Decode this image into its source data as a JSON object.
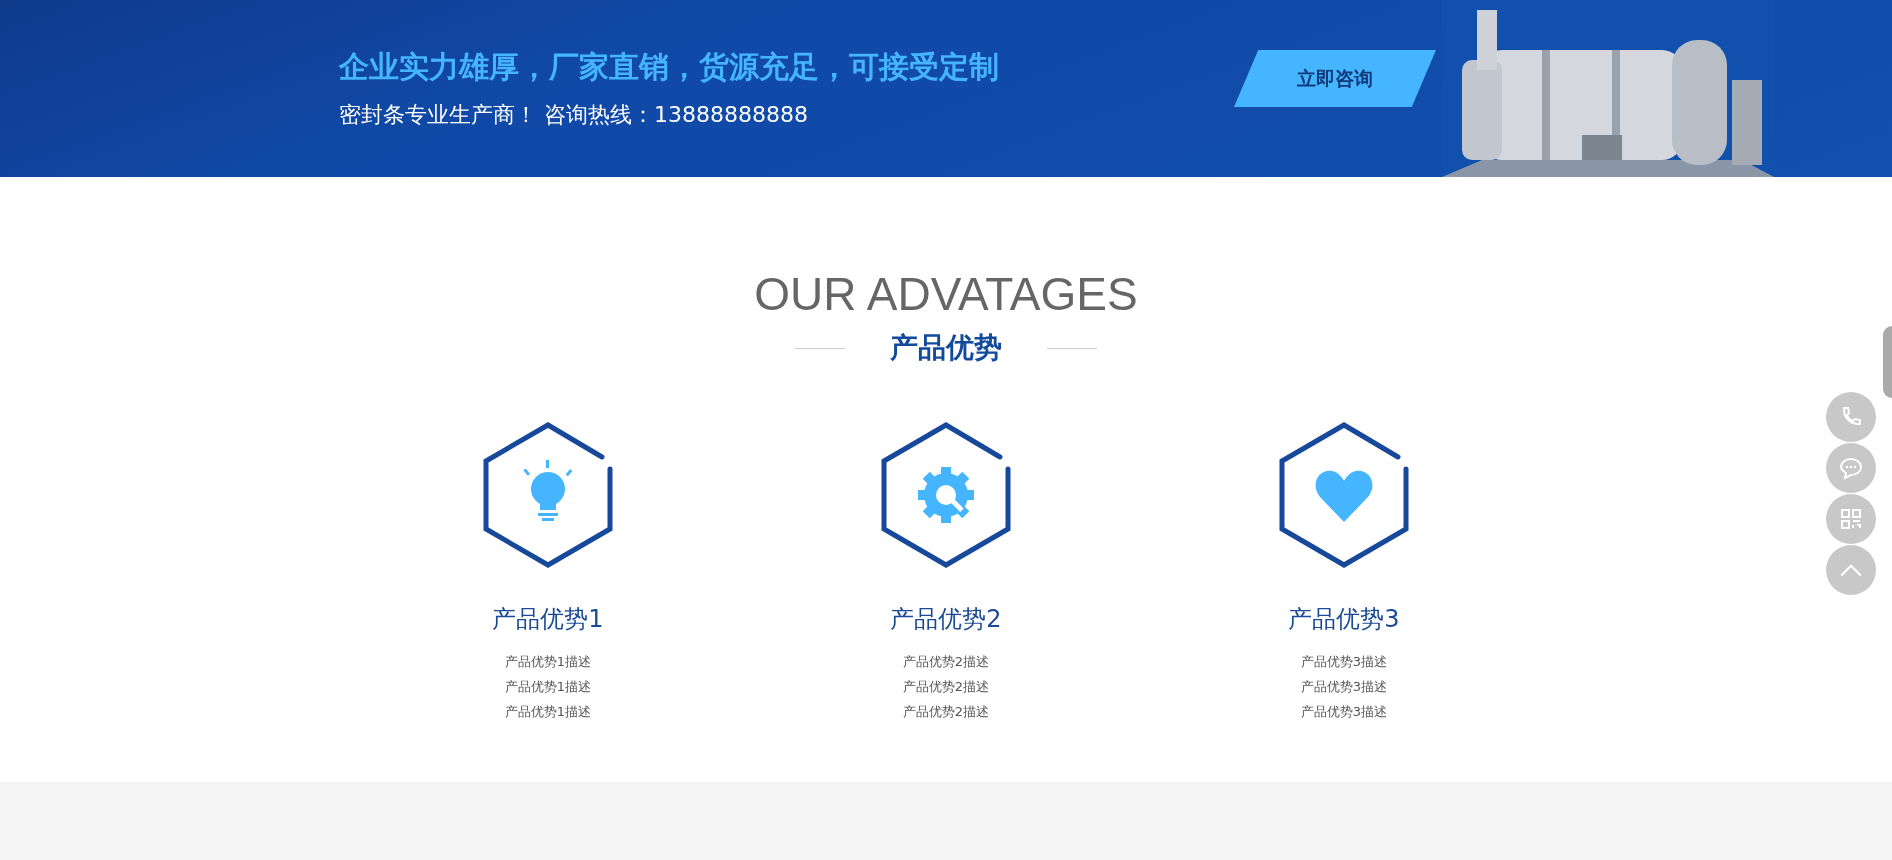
{
  "banner": {
    "headline": "企业实力雄厚，厂家直销，货源充足，可接受定制",
    "subline": "密封条专业生产商！ 咨询热线：13888888888",
    "button": "立即咨询"
  },
  "advantages": {
    "title_en": "OUR ADVATAGES",
    "title_zh": "产品优势",
    "items": [
      {
        "kind": "bulb",
        "title": "产品优势1",
        "lines": [
          "产品优势1描述",
          "产品优势1描述",
          "产品优势1描述"
        ]
      },
      {
        "kind": "gear",
        "title": "产品优势2",
        "lines": [
          "产品优势2描述",
          "产品优势2描述",
          "产品优势2描述"
        ]
      },
      {
        "kind": "heart",
        "title": "产品优势3",
        "lines": [
          "产品优势3描述",
          "产品优势3描述",
          "产品优势3描述"
        ]
      }
    ]
  },
  "side_buttons": [
    {
      "kind": "phone"
    },
    {
      "kind": "chat"
    },
    {
      "kind": "qr"
    },
    {
      "kind": "top"
    }
  ]
}
